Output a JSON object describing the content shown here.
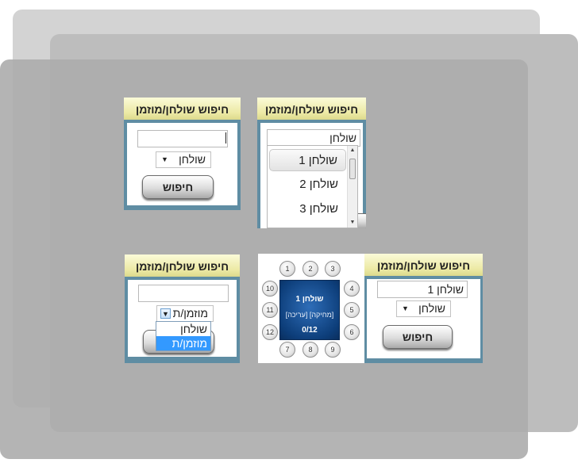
{
  "widget_title": "חיפוש שולחן/מוזמן",
  "search_button": "חיפוש",
  "panel1": {
    "input_value": "",
    "select_value": "שולחן"
  },
  "panel2": {
    "input_value": "שולחן",
    "options": [
      "שולחן 1",
      "שולחן 2",
      "שולחן 3"
    ],
    "highlighted_option": "שולחן 1"
  },
  "panel3": {
    "input_value": "",
    "select_value": "מוזמן/ת",
    "options": [
      "שולחן",
      "מוזמן/ת"
    ],
    "selected_option": "מוזמן/ת"
  },
  "panel4": {
    "input_value": "שולחן 1",
    "select_value": "שולחן",
    "table": {
      "name": "שולחן 1",
      "actions": "[מחיקה] [עריכה]",
      "count": "0/12",
      "seats": [
        "1",
        "2",
        "3",
        "4",
        "5",
        "6",
        "7",
        "8",
        "9",
        "10",
        "11",
        "12"
      ]
    }
  }
}
